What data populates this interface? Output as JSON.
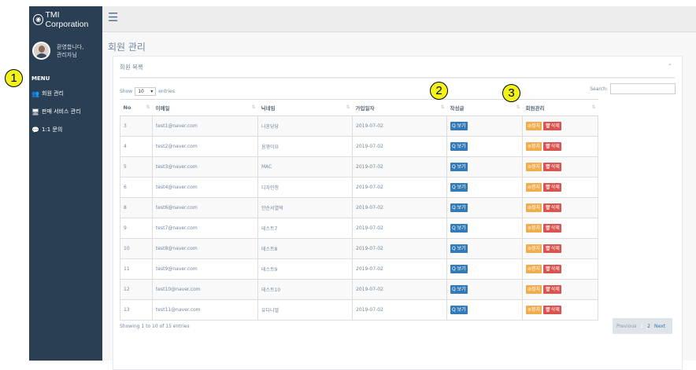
{
  "brand": {
    "name": "TMI Corporation",
    "logo_icon": "camera-icon"
  },
  "profile": {
    "greeting": "환영합니다,",
    "name": "관리자님"
  },
  "sidebar": {
    "menu_title": "MENU",
    "items": [
      {
        "label": "회원 관리",
        "icon": "users-icon"
      },
      {
        "label": "판매 서비스 관리",
        "icon": "desktop-icon"
      },
      {
        "label": "1:1 문의",
        "icon": "comment-icon"
      }
    ]
  },
  "page": {
    "title": "회원 관리"
  },
  "panel": {
    "title": "회원 목록"
  },
  "table_controls": {
    "show_label": "Show",
    "entries_value": "10",
    "entries_label": "entries",
    "search_label": "Search:"
  },
  "table": {
    "headers": [
      "No",
      "이메일",
      "닉네임",
      "가입일자",
      "작성글",
      "회원관리"
    ],
    "rows": [
      {
        "no": "3",
        "email": "test1@naver.com",
        "nick": "나혼당당",
        "date": "2019-07-02"
      },
      {
        "no": "4",
        "email": "test2@naver.com",
        "nick": "음영이요",
        "date": "2019-07-02"
      },
      {
        "no": "5",
        "email": "test3@naver.com",
        "nick": "MAC",
        "date": "2019-07-02"
      },
      {
        "no": "6",
        "email": "test4@naver.com",
        "nick": "디자인청",
        "date": "2019-07-02"
      },
      {
        "no": "8",
        "email": "test6@naver.com",
        "nick": "안순서열떡",
        "date": "2019-07-02"
      },
      {
        "no": "9",
        "email": "test7@naver.com",
        "nick": "테스트7",
        "date": "2019-07-02"
      },
      {
        "no": "10",
        "email": "test8@naver.com",
        "nick": "테스트8",
        "date": "2019-07-02"
      },
      {
        "no": "11",
        "email": "test9@naver.com",
        "nick": "테스트9",
        "date": "2019-07-02"
      },
      {
        "no": "12",
        "email": "test10@naver.com",
        "nick": "테스트10",
        "date": "2019-07-02"
      },
      {
        "no": "13",
        "email": "test11@naver.com",
        "nick": "유다니엘",
        "date": "2019-07-02"
      }
    ],
    "view_label": "Q 보기",
    "stop_label": "⊘정지",
    "delete_label": "🗑삭제"
  },
  "info": "Showing 1 to 10 of 15 entries",
  "pagination": {
    "previous": "Previous",
    "page1": "1",
    "page2": "2",
    "next": "Next"
  },
  "markers": [
    "1",
    "2",
    "3"
  ],
  "colors": {
    "sidebar": "#2a3f54",
    "view": "#337ab7",
    "stop": "#f0ad4e",
    "delete": "#d9534f",
    "marker": "#f3f31c"
  }
}
